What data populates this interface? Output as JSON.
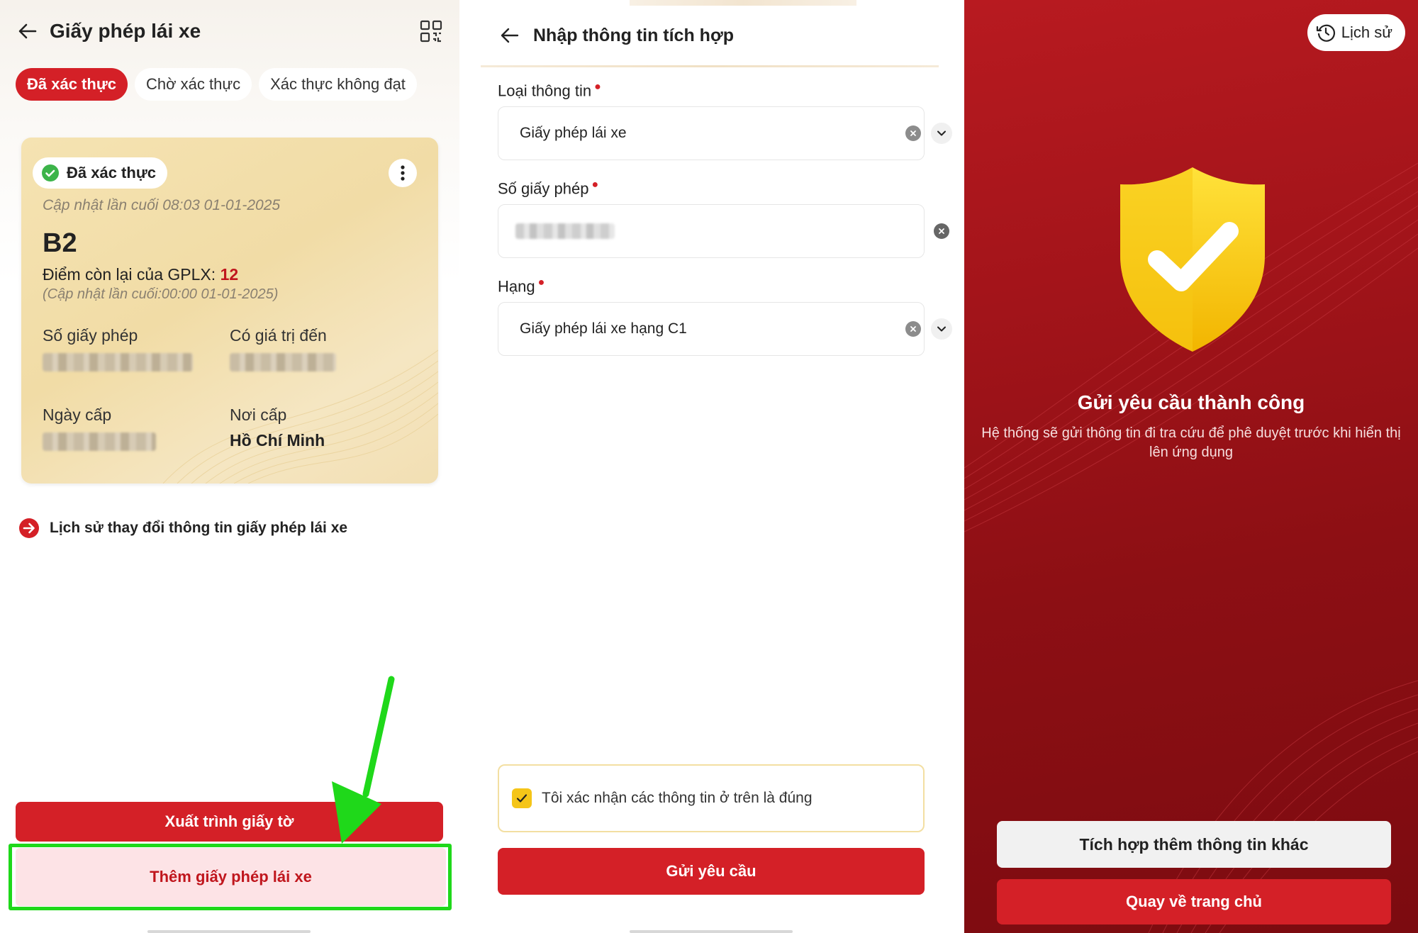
{
  "panel1": {
    "title": "Giấy phép lái xe",
    "tabs": [
      "Đã xác thực",
      "Chờ xác thực",
      "Xác thực không đạt"
    ],
    "card": {
      "status": "Đã xác thực",
      "last_updated": "Cập nhật lần cuối 08:03 01-01-2025",
      "license_class": "B2",
      "points_label": "Điểm còn lại của GPLX:",
      "points_value": "12",
      "points_updated": "(Cập nhật lần cuối:00:00 01-01-2025)",
      "license_number_label": "Số giấy phép",
      "valid_until_label": "Có giá trị đến",
      "issue_date_label": "Ngày cấp",
      "issue_place_label": "Nơi cấp",
      "issue_place_value": "Hồ Chí Minh"
    },
    "history_link": "Lịch sử thay đổi thông tin giấy phép lái xe",
    "present_button": "Xuất trình giấy tờ",
    "add_button": "Thêm giấy phép lái xe"
  },
  "panel2": {
    "title": "Nhập thông tin tích hợp",
    "info_type_label": "Loại thông tin",
    "info_type_value": "Giấy phép lái xe",
    "license_number_label": "Số giấy phép",
    "class_label": "Hạng",
    "class_value": "Giấy phép lái xe hạng C1",
    "confirm_text": "Tôi xác nhận các thông tin ở trên là đúng",
    "submit_button": "Gửi yêu cầu"
  },
  "panel3": {
    "history_button": "Lịch sử",
    "success_title": "Gửi yêu cầu thành công",
    "success_desc": "Hệ thống sẽ gửi thông tin đi tra cứu để phê duyệt trước khi hiển thị lên ứng dụng",
    "integrate_more_button": "Tích hợp thêm thông tin khác",
    "home_button": "Quay về trang chủ"
  },
  "colors": {
    "primary_red": "#d42027",
    "highlight_green": "#1fd81a",
    "verified_green": "#3cb44a",
    "checkbox_yellow": "#f5c518"
  }
}
